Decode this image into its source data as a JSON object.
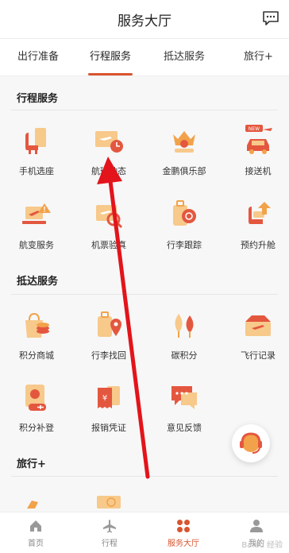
{
  "header": {
    "title": "服务大厅",
    "message_icon": "message-icon"
  },
  "tabs": [
    {
      "label": "出行准备"
    },
    {
      "label": "行程服务"
    },
    {
      "label": "抵达服务"
    },
    {
      "label": "旅行+"
    }
  ],
  "sections": [
    {
      "title": "行程服务",
      "items": [
        {
          "label": "手机选座",
          "icon": "seat-select-icon"
        },
        {
          "label": "航班动态",
          "icon": "flight-status-icon"
        },
        {
          "label": "金鹏俱乐部",
          "icon": "club-crown-icon"
        },
        {
          "label": "接送机",
          "icon": "car-transfer-icon"
        },
        {
          "label": "航变服务",
          "icon": "flight-change-icon"
        },
        {
          "label": "机票验真",
          "icon": "ticket-verify-icon"
        },
        {
          "label": "行李跟踪",
          "icon": "baggage-track-icon"
        },
        {
          "label": "预约升舱",
          "icon": "upgrade-seat-icon"
        }
      ]
    },
    {
      "title": "抵达服务",
      "items": [
        {
          "label": "积分商城",
          "icon": "points-mall-icon"
        },
        {
          "label": "行李找回",
          "icon": "baggage-find-icon"
        },
        {
          "label": "碳积分",
          "icon": "carbon-tree-icon"
        },
        {
          "label": "飞行记录",
          "icon": "flight-record-icon"
        },
        {
          "label": "积分补登",
          "icon": "points-supplement-icon"
        },
        {
          "label": "报销凭证",
          "icon": "receipt-icon"
        },
        {
          "label": "意见反馈",
          "icon": "feedback-icon"
        }
      ]
    },
    {
      "title": "旅行+"
    }
  ],
  "bottom_nav": [
    {
      "label": "首页",
      "icon": "home-icon"
    },
    {
      "label": "行程",
      "icon": "plane-icon"
    },
    {
      "label": "服务大厅",
      "icon": "grid-dots-icon"
    },
    {
      "label": "我的",
      "icon": "user-icon"
    }
  ],
  "colors": {
    "accent": "#d9552f",
    "icon_orange": "#f2a24a",
    "icon_red": "#e4573f",
    "arrow_red": "#e3141b"
  },
  "watermark": "Baidu 经验"
}
